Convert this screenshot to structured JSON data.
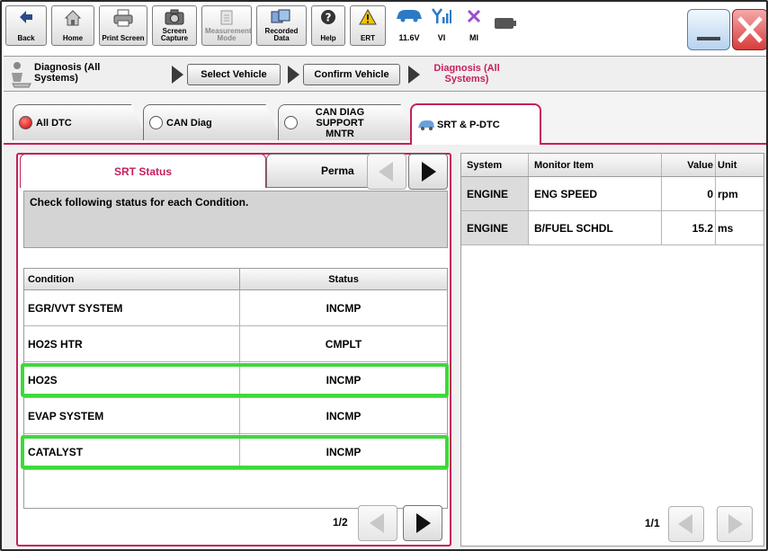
{
  "toolbar": {
    "back": "Back",
    "home": "Home",
    "print_screen": "Print Screen",
    "screen_capture": "Screen Capture",
    "measurement_mode": "Measurement Mode",
    "recorded_data": "Recorded Data",
    "help": "Help",
    "ert": "ERT",
    "voltage": "11.6V",
    "vi": "VI",
    "mi": "MI"
  },
  "breadcrumb": {
    "root": "Diagnosis (All Systems)",
    "select_vehicle": "Select Vehicle",
    "confirm_vehicle": "Confirm Vehicle",
    "current": "Diagnosis (All Systems)"
  },
  "tabs": {
    "all_dtc": "All DTC",
    "can_diag": "CAN Diag",
    "can_diag_support": "CAN DIAG SUPPORT MNTR",
    "srt_pdtc": "SRT & P-DTC"
  },
  "left": {
    "tab_srt": "SRT Status",
    "tab_perma": "Perma",
    "message": "Check following status for each Condition.",
    "headers": [
      "Condition",
      "Status"
    ],
    "rows": [
      {
        "condition": "EGR/VVT SYSTEM",
        "status": "INCMP",
        "highlight": false
      },
      {
        "condition": "HO2S HTR",
        "status": "CMPLT",
        "highlight": false
      },
      {
        "condition": "HO2S",
        "status": "INCMP",
        "highlight": true
      },
      {
        "condition": "EVAP SYSTEM",
        "status": "INCMP",
        "highlight": false
      },
      {
        "condition": "CATALYST",
        "status": "INCMP",
        "highlight": true
      }
    ],
    "page": "1/2"
  },
  "right": {
    "headers": [
      "System",
      "Monitor Item",
      "Value",
      "Unit"
    ],
    "rows": [
      {
        "system": "ENGINE",
        "item": "ENG SPEED",
        "value": "0",
        "unit": "rpm"
      },
      {
        "system": "ENGINE",
        "item": "B/FUEL SCHDL",
        "value": "15.2",
        "unit": "ms"
      }
    ],
    "page": "1/1"
  },
  "colors": {
    "accent": "#c4205c",
    "highlight": "#3fd83a",
    "close_red": "#e05050"
  }
}
